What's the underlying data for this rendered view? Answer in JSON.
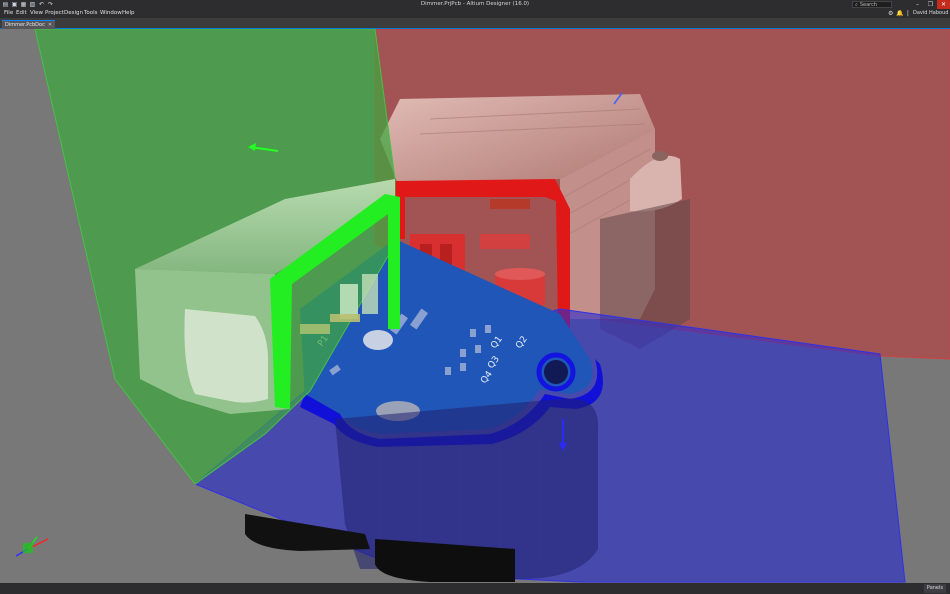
{
  "window": {
    "title": "Dimmer.PrjPcb - Altium Designer (16.0)",
    "search_placeholder": "Search",
    "minimize_glyph": "–",
    "maximize_glyph": "❐",
    "close_glyph": "✕"
  },
  "toolbar_icons": [
    "new-icon",
    "open-icon",
    "save-icon",
    "save-all-icon",
    "undo-icon",
    "redo-icon"
  ],
  "menu": {
    "items": [
      "File",
      "Edit",
      "View",
      "Project",
      "Design",
      "Tools",
      "Window",
      "Help"
    ],
    "user": "David Haboud ▾"
  },
  "tabs": {
    "active": "Dimmer.PcbDoc"
  },
  "statusbar": {
    "panels_label": "Panels"
  },
  "viewport": {
    "silkscreen": {
      "p1": "P1",
      "q1": "Q1",
      "q2": "Q2",
      "q3": "Q3",
      "q4": "Q4"
    },
    "colors": {
      "background": "#777877",
      "x_plane": "#3ea83e",
      "y_plane": "#b44848",
      "z_plane": "#2a2ad4",
      "pcb": "#1f56b8",
      "enclosure": "#d8a8a0"
    }
  }
}
